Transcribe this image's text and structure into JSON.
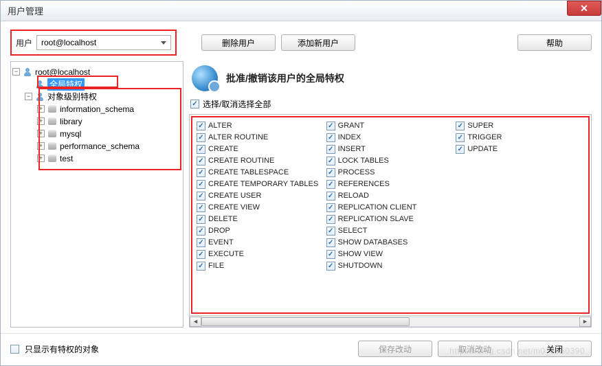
{
  "window": {
    "title": "用户管理"
  },
  "toolbar": {
    "user_label": "用户",
    "selected_user": "root@localhost",
    "delete_user": "删除用户",
    "add_user": "添加新用户",
    "help": "帮助"
  },
  "tree": {
    "root": "root@localhost",
    "global_priv": "全局特权",
    "object_priv": "对象级别特权",
    "databases": [
      "information_schema",
      "library",
      "mysql",
      "performance_schema",
      "test"
    ]
  },
  "panel": {
    "heading": "批准/撤销该用户的全局特权",
    "select_all": "选择/取消选择全部"
  },
  "privileges": {
    "col1": [
      "ALTER",
      "ALTER ROUTINE",
      "CREATE",
      "CREATE ROUTINE",
      "CREATE TABLESPACE",
      "CREATE TEMPORARY TABLES",
      "CREATE USER",
      "CREATE VIEW",
      "DELETE",
      "DROP",
      "EVENT",
      "EXECUTE",
      "FILE"
    ],
    "col2": [
      "GRANT",
      "INDEX",
      "INSERT",
      "LOCK TABLES",
      "PROCESS",
      "REFERENCES",
      "RELOAD",
      "REPLICATION CLIENT",
      "REPLICATION SLAVE",
      "SELECT",
      "SHOW DATABASES",
      "SHOW VIEW",
      "SHUTDOWN"
    ],
    "col3": [
      "SUPER",
      "TRIGGER",
      "UPDATE"
    ]
  },
  "footer": {
    "show_priv_only": "只显示有特权的对象",
    "save": "保存改动",
    "cancel": "取消改动",
    "close": "关闭"
  },
  "watermark": "https://blog.csdn.net/m0_5550390"
}
